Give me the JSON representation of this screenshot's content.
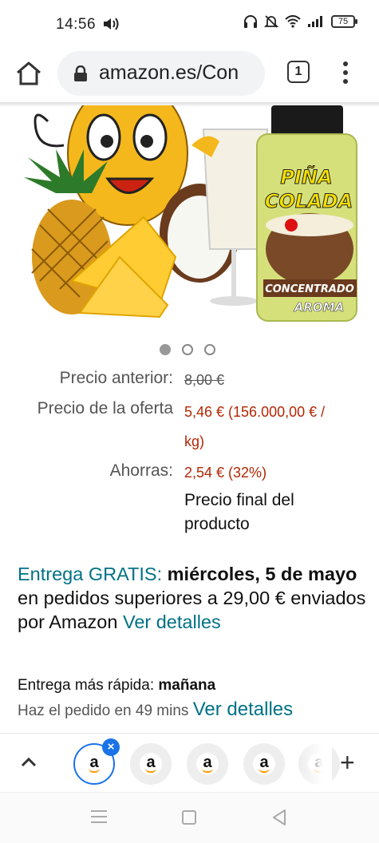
{
  "status_bar": {
    "time": "14:56",
    "battery": "75",
    "icons": [
      "volume-icon",
      "headphones-icon",
      "mute-icon",
      "wifi-icon",
      "signal-icon",
      "battery-icon"
    ]
  },
  "browser": {
    "url": "amazon.es/Con",
    "tab_count": "1",
    "icons": [
      "home-icon",
      "lock-icon",
      "tabs-icon",
      "more-vert-icon"
    ]
  },
  "product_image": {
    "label_line1": "PIÑA",
    "label_line2": "COLADA",
    "label_line3": "CONCENTRADO",
    "label_line4": "AROMA",
    "colors": {
      "jar_cap": "#1a1a1a",
      "jar_body": "#d6e07a",
      "pineapple": "#f5b81c",
      "coconut": "#6b3b1e"
    }
  },
  "carousel": {
    "total": 3,
    "active_index": 0
  },
  "prices": {
    "previous_label": "Precio anterior:",
    "previous_value": "8,00 €",
    "offer_label": "Precio de la oferta",
    "offer_value_line1": "5,46 € (156.000,00 € /",
    "offer_value_line2": "kg)",
    "savings_label": "Ahorras:",
    "savings_value": "2,54 € (32%)",
    "final_note_line1": "Precio final del",
    "final_note_line2": "producto"
  },
  "delivery": {
    "free_label": "Entrega GRATIS:",
    "date": "miércoles, 5 de mayo",
    "condition": "en pedidos superiores a 29,00 € enviados por Amazon",
    "details_link": "Ver detalles"
  },
  "fastest": {
    "label": "Entrega más rápida:",
    "day": "mañana",
    "order_text": "Haz el pedido en 49 mins",
    "details_link": "Ver detalles"
  },
  "tab_group": {
    "tab_letter": "a",
    "close_glyph": "×",
    "add_glyph": "+"
  },
  "colors": {
    "price_red": "#b12704",
    "link_teal": "#007185",
    "active_blue": "#1a73e8",
    "amazon_orange": "#ff9900"
  }
}
